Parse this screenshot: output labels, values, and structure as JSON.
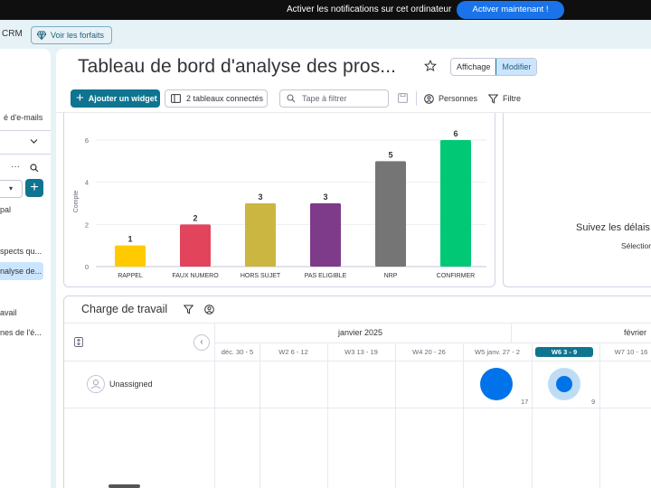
{
  "notification": {
    "text": "Activer les notifications sur cet ordinateur",
    "button": "Activer maintenant !"
  },
  "topbar": {
    "app_name": "CRM",
    "plans_button": "Voir les forfaits"
  },
  "sidebar": {
    "item_emails": "é d'e-mails",
    "selector_value": "",
    "item_principal": "pal",
    "item_prospects": "spects qu...",
    "item_analyse": "nalyse de...",
    "item_travail": "avail",
    "item_mes": "nes de l'é..."
  },
  "header": {
    "title": "Tableau de bord d'analyse des pros...",
    "view_label": "Affichage",
    "edit_label": "Modifier"
  },
  "toolbar": {
    "add_widget": "Ajouter un widget",
    "connected_boards": "2 tableaux connectés",
    "filter_placeholder": "Tape à filtrer",
    "people": "Personnes",
    "filter": "Filtre"
  },
  "chart_data": {
    "type": "bar",
    "categories": [
      "RAPPEL",
      "FAUX NUMERO",
      "HORS SUJET",
      "PAS ELIGIBLE",
      "NRP",
      "CONFIRMER"
    ],
    "values": [
      1,
      2,
      3,
      3,
      5,
      6
    ],
    "colors": [
      "#ffcb00",
      "#e2445c",
      "#cab641",
      "#7e3b8a",
      "#757575",
      "#00c875"
    ],
    "ylabel": "Compte",
    "ylim": [
      0,
      6
    ],
    "yticks": [
      0,
      2,
      4,
      6
    ],
    "grid": true
  },
  "side_widget": {
    "title": "Suivez les délais",
    "subtitle": "Sélection"
  },
  "workload": {
    "title": "Charge de travail",
    "months": [
      "janvier 2025",
      "février"
    ],
    "weeks": [
      "déc. 30 - 5",
      "W2 6 - 12",
      "W3 13 - 19",
      "W4 20 - 26",
      "W5 janv. 27 - 2",
      "W6 3 - 9",
      "W7 10 - 16"
    ],
    "row_label": "Unassigned",
    "counts": [
      "17",
      "9"
    ]
  }
}
